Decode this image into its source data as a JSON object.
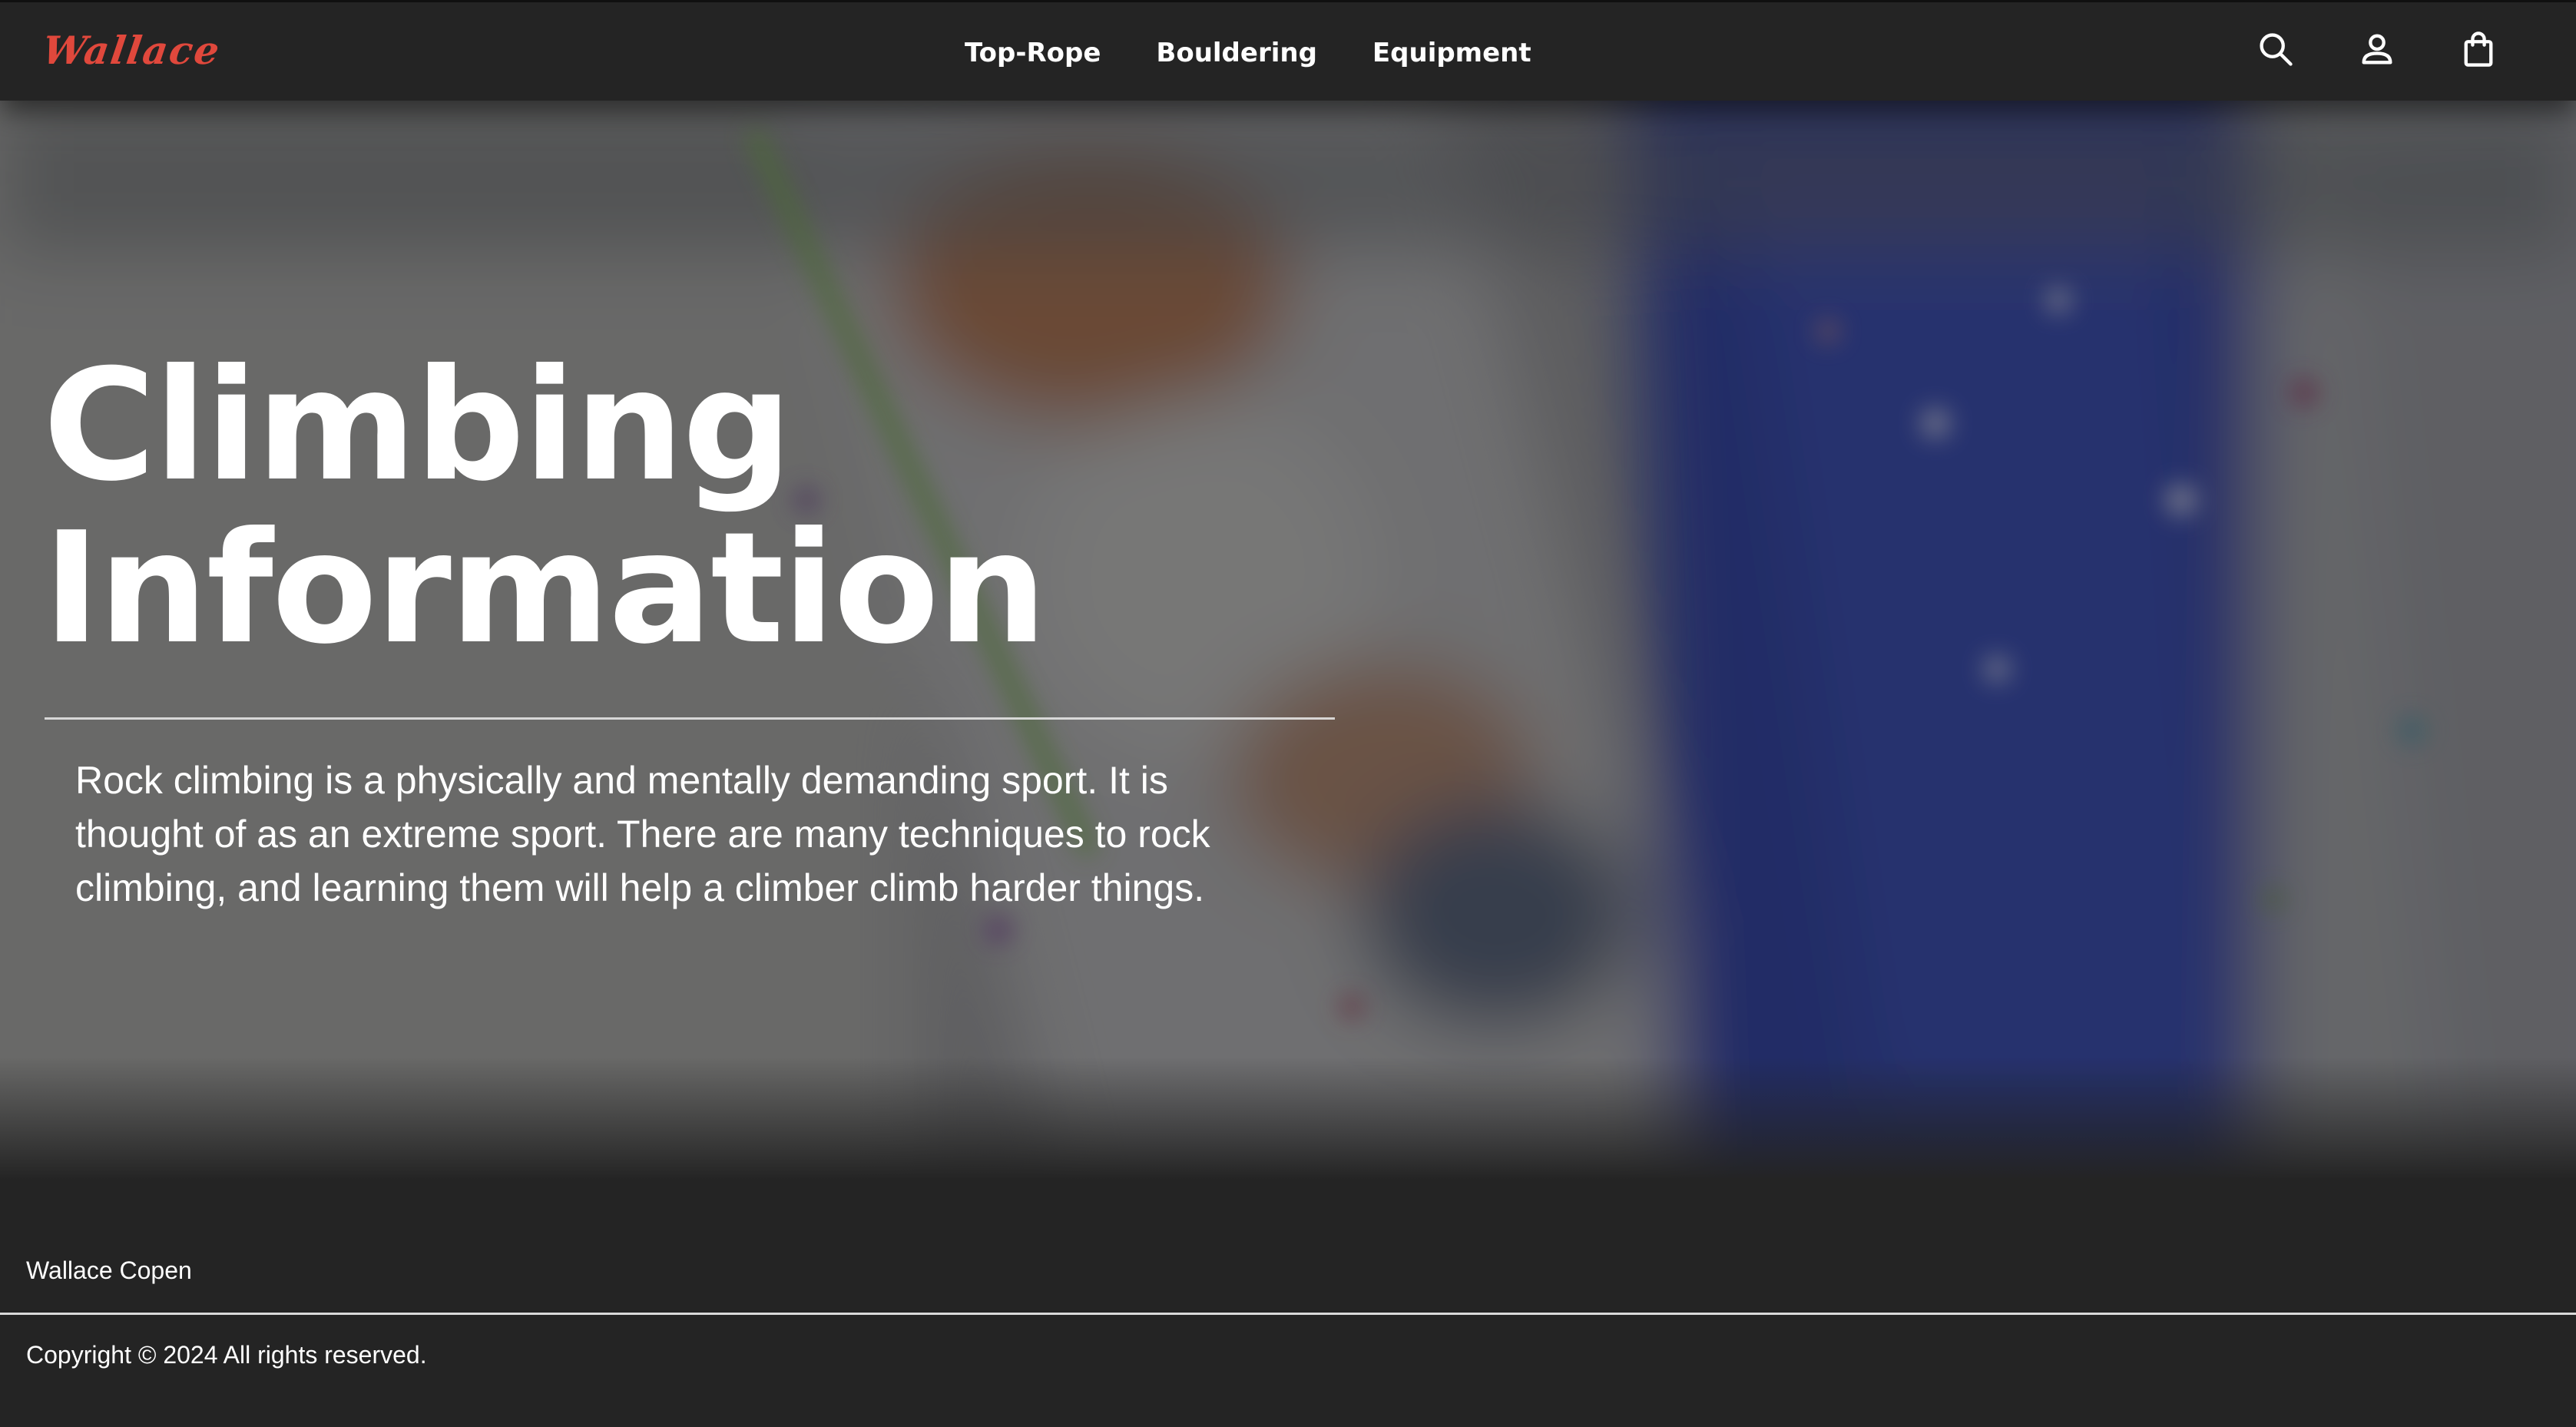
{
  "brand": {
    "logo_text": "Wallace",
    "logo_color": "#e0483c"
  },
  "nav": {
    "links": [
      {
        "label": "Top-Rope"
      },
      {
        "label": "Bouldering"
      },
      {
        "label": "Equipment"
      }
    ],
    "icons": [
      "search-icon",
      "user-icon",
      "shopping-bag-icon"
    ]
  },
  "hero": {
    "title_line1": "Climbing",
    "title_line2": "Information",
    "body": "Rock climbing is a physically and mentally demanding sport. It is thought of as an extreme sport. There are many techniques to rock climbing, and learning them will help a climber climb harder things.",
    "background": "blurred-climbing-wall-photo"
  },
  "footer": {
    "name": "Wallace Copen",
    "copyright": "Copyright © 2024 All rights reserved."
  },
  "colors": {
    "nav_bg": "#242424",
    "footer_bg": "#242424",
    "wall_blue": "#1e2f8a",
    "text": "#ffffff"
  }
}
